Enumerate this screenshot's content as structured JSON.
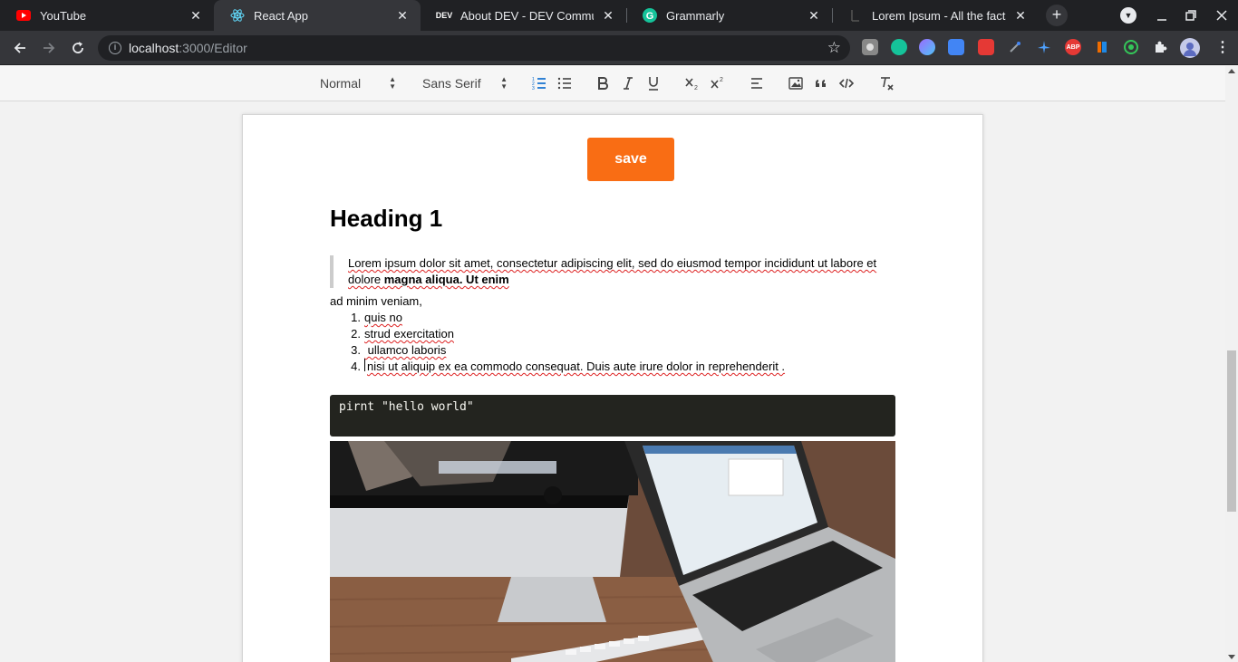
{
  "browser": {
    "tabs": [
      {
        "title": "YouTube",
        "icon": "youtube-icon"
      },
      {
        "title": "React App",
        "icon": "react-icon"
      },
      {
        "title": "About DEV - DEV Communit",
        "icon": "dev-icon"
      },
      {
        "title": "Grammarly",
        "icon": "grammarly-icon"
      },
      {
        "title": "Lorem Ipsum - All the facts",
        "icon": "lorem-ipsum-icon"
      }
    ],
    "active_tab": 1,
    "new_tab_label": "+",
    "url_host": "localhost",
    "url_path": ":3000/Editor",
    "dev_badge": "DEV"
  },
  "editor_toolbar": {
    "header_select": "Normal",
    "font_select": "Sans Serif"
  },
  "document": {
    "save_label": "save",
    "heading": "Heading 1",
    "blockquote": {
      "line1": "Lorem ipsum dolor sit amet, consectetur adipiscing elit, sed do eiusmod tempor incididunt ut labore et",
      "line2_plain": "dolore ",
      "line2_bold": "magna aliqua. Ut enim"
    },
    "paragraph": "ad minim veniam,",
    "ordered_list": [
      {
        "num": "1.",
        "text": "quis no"
      },
      {
        "num": "2.",
        "text": "strud exercitation"
      },
      {
        "num": "3.",
        "text": " ullamco laboris"
      },
      {
        "num": "4.",
        "text": "nisi ut aliquip ex ea commodo consequat. Duis aute irure dolor in reprehenderit ."
      }
    ],
    "code": "pirnt \"hello world\""
  },
  "colors": {
    "save_button": "#f96d14",
    "active_list_button": "#06c",
    "code_background": "#23241f"
  }
}
